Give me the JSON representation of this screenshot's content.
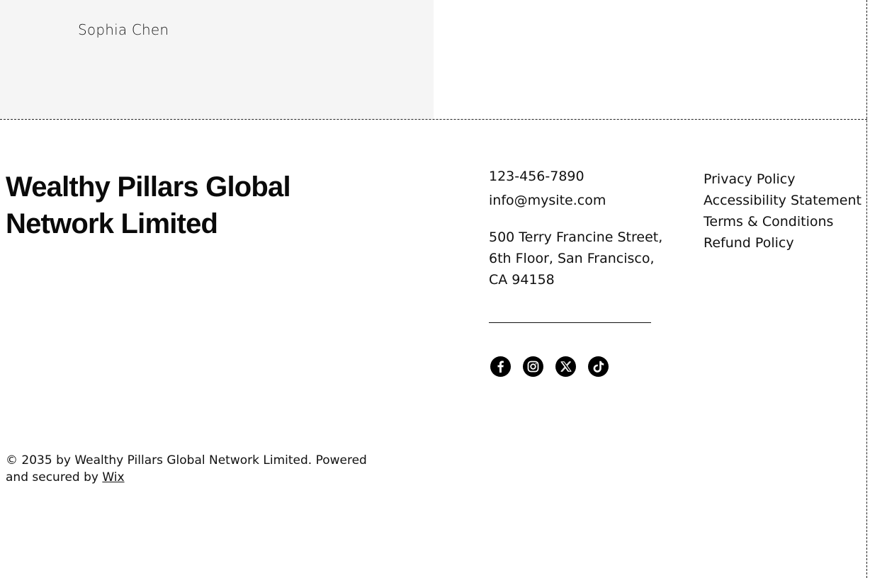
{
  "testimonial": {
    "author": "Sophia Chen"
  },
  "footer": {
    "brand_line1": "Wealthy Pillars Global",
    "brand_line2": "Network Limited",
    "contact": {
      "phone": "123-456-7890",
      "email": "info@mysite.com",
      "address_line1": "500 Terry Francine Street,",
      "address_line2": "6th Floor, San Francisco,",
      "address_line3": "CA 94158"
    },
    "socials": [
      {
        "name": "Facebook",
        "icon": "facebook-icon"
      },
      {
        "name": "Instagram",
        "icon": "instagram-icon"
      },
      {
        "name": "X",
        "icon": "x-icon"
      },
      {
        "name": "TikTok",
        "icon": "tiktok-icon"
      }
    ],
    "policies": [
      "Privacy Policy",
      "Accessibility Statement",
      "Terms & Conditions",
      "Refund Policy"
    ],
    "copyright_text": "© 2035 by Wealthy Pillars Global Network Limited. Powered and secured by",
    "wix_link": "Wix"
  },
  "colors": {
    "card_background": "#f5f5f5",
    "text": "#111111",
    "icon_fill": "#000000"
  }
}
